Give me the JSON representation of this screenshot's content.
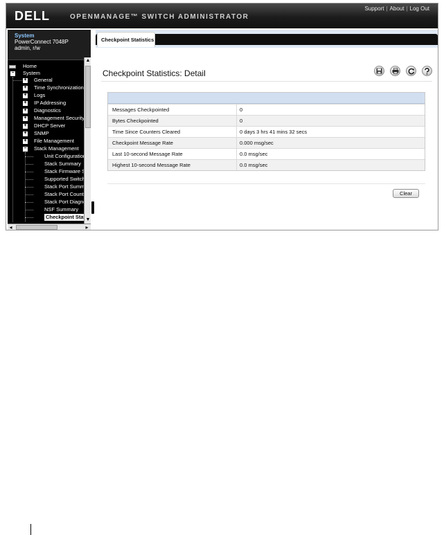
{
  "header": {
    "logo": "DELL",
    "app_title": "OPENMANAGE™ SWITCH ADMINISTRATOR",
    "links": [
      "Support",
      "About",
      "Log Out"
    ],
    "separator": "|"
  },
  "system": {
    "title": "System",
    "model": "PowerConnect 7048P",
    "user": "admin, r/w"
  },
  "tree": {
    "home": "Home",
    "system": "System",
    "general": "General",
    "time_sync": "Time Synchronization",
    "logs": "Logs",
    "ip_addressing": "IP Addressing",
    "diagnostics": "Diagnostics",
    "management_security": "Management Security",
    "dhcp_server": "DHCP Server",
    "snmp": "SNMP",
    "file_management": "File Management",
    "stack_management": "Stack Management",
    "unit_configuration": "Unit Configuration",
    "stack_summary": "Stack Summary",
    "stack_firmware": "Stack Firmware Synchronization",
    "supported_switches": "Supported Switches",
    "stack_port_summary": "Stack Port Summary",
    "stack_port_counters": "Stack Port Counters",
    "stack_port_diagnostics": "Stack Port Diagnostics",
    "nsf_summary": "NSF Summary",
    "checkpoint_statistics": "Checkpoint Statistics",
    "expand_symbol": "+",
    "collapse_symbol": "−"
  },
  "tab": {
    "label": "Checkpoint Statistics"
  },
  "page": {
    "title": "Checkpoint Statistics: Detail"
  },
  "toolbar": [
    "save-icon",
    "print-icon",
    "refresh-icon",
    "help-icon"
  ],
  "stats": [
    {
      "label": "Messages Checkpointed",
      "value": "0"
    },
    {
      "label": "Bytes Checkpointed",
      "value": "0"
    },
    {
      "label": "Time Since Counters Cleared",
      "value": "0 days 3 hrs 41 mins 32 secs"
    },
    {
      "label": "Checkpoint Message Rate",
      "value": "0.000 msg/sec"
    },
    {
      "label": "Last 10-second Message Rate",
      "value": "0.0 msg/sec"
    },
    {
      "label": "Highest 10-second Message Rate",
      "value": "0.0 msg/sec"
    }
  ],
  "buttons": {
    "clear": "Clear"
  }
}
